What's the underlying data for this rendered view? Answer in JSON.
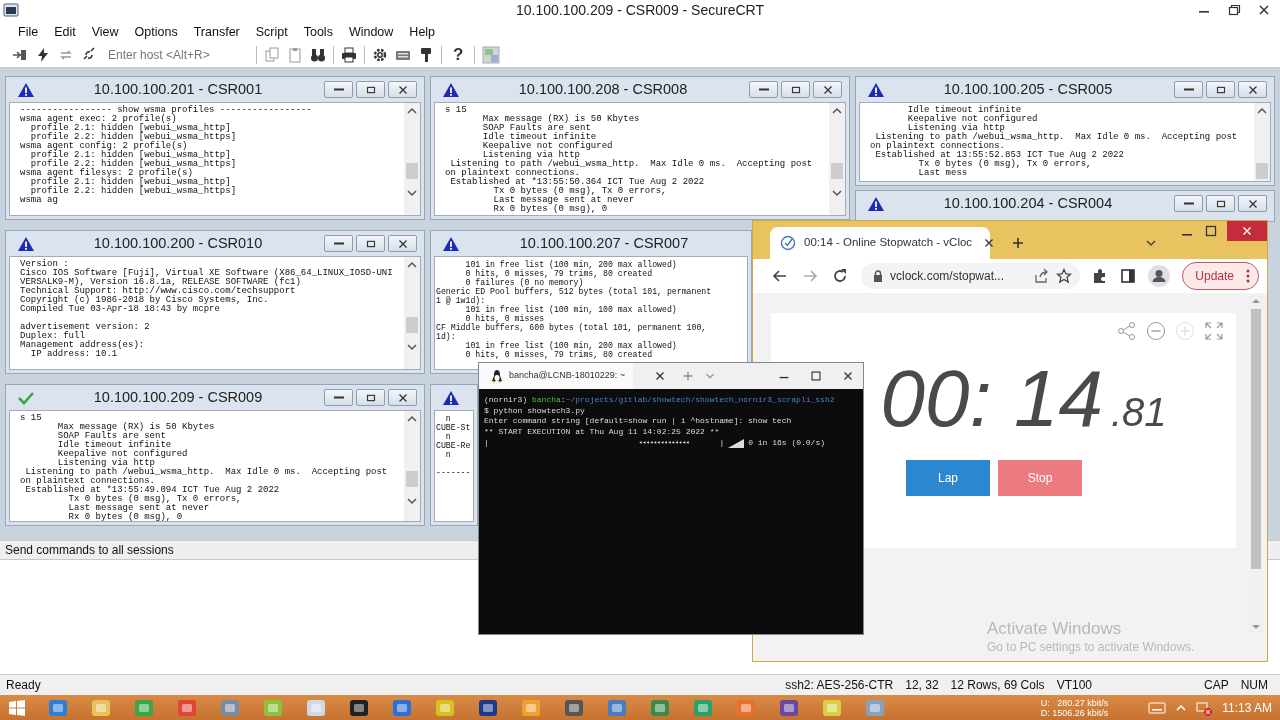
{
  "window": {
    "title": "10.100.100.209 - CSR009 - SecureCRT"
  },
  "menu": [
    "File",
    "Edit",
    "View",
    "Options",
    "Transfer",
    "Script",
    "Tools",
    "Window",
    "Help"
  ],
  "toolbar": {
    "host_placeholder": "Enter host <Alt+R>",
    "help_glyph": "?"
  },
  "sessions": [
    {
      "title": "10.100.100.201 - CSR001",
      "connected": false,
      "blocks": [
        [
          "----------------- show wsma profiles -----------------",
          "wsma agent exec: 2 profile(s)",
          "  profile 2.1: hidden [webui_wsma_http]",
          "  profile 2.2: hidden [webui_wsma_https]",
          "wsma agent config: 2 profile(s)",
          "  profile 2.1: hidden [webui_wsma_http]",
          "  profile 2.2: hidden [webui_wsma_https]",
          "wsma agent filesys: 2 profile(s)",
          "  profile 2.1: hidden [webui_wsma_http]",
          "  profile 2.2: hidden [webui_wsma_https]",
          "wsma ag"
        ]
      ]
    },
    {
      "title": "10.100.100.208 - CSR008",
      "connected": false,
      "blocks": [
        [
          "s 15",
          "       Max message (RX) is 50 Kbytes",
          "       SOAP Faults are sent",
          "       Idle timeout infinite",
          "       Keepalive not configured",
          "       Listening via http",
          " Listening to path /webui_wsma_http.  Max Idle 0 ms.  Accepting post",
          "on plaintext connections.",
          " Established at *13:55:50.364 ICT Tue Aug 2 2022",
          "         Tx 0 bytes (0 msg), Tx 0 errors,",
          "         Last message sent at never",
          "         Rx 0 bytes (0 msg), 0"
        ]
      ]
    },
    {
      "title": "10.100.100.205 - CSR005",
      "connected": false,
      "blocks": [
        [
          "       Idle timeout infinite",
          "       Keepalive not configured",
          "       Listening via http",
          " Listening to path /webui_wsma_http.  Max Idle 0 ms.  Accepting post",
          "on plaintext connections.",
          " Established at 13:55:52.853 ICT Tue Aug 2 2022",
          "         Tx 0 bytes (0 msg), Tx 0 errors,",
          "         Last mess"
        ]
      ]
    },
    {
      "title": "10.100.100.200 - CSR010",
      "connected": false,
      "blocks": [
        [
          "Version :",
          "Cisco IOS Software [Fuji], Virtual XE Software (X86_64_LINUX_IOSD-UNI",
          "VERSALK9-M), Version 16.8.1a, RELEASE SOFTWARE (fc1)",
          "Technical Support: http://www.cisco.com/techsupport",
          "Copyright (c) 1986-2018 by Cisco Systems, Inc.",
          "Compiled Tue 03-Apr-18 18:43 by mcpre"
        ],
        [
          "advertisement version: 2",
          "Duplex: full",
          "Management address(es):",
          "  IP address: 10.1"
        ]
      ]
    },
    {
      "title": "10.100.100.207 - CSR007",
      "connected": false,
      "blocks": [
        [
          "      101 in free list (100 min, 200 max allowed)",
          "      0 hits, 0 misses, 79 trims, 80 created",
          "      0 failures (0 no memory)",
          "Generic ED Pool buffers, 512 bytes (total 101, permanent",
          "1 @ 1w1d):",
          "      101 in free list (100 min, 100 max allowed)",
          "      0 hits, 0 misses",
          "CF Middle buffers, 600 bytes (total 101, permanent 100,",
          "1d):",
          "      101 in free list (100 min, 200 max allowed)",
          "      0 hits, 0 misses, 79 trims, 80 created"
        ]
      ]
    },
    {
      "title": "10.100.100.204 - CSR004",
      "connected": false
    },
    {
      "title": "10.100.100.209 - CSR009",
      "connected": true,
      "blocks": [
        [
          "s 15",
          "       Max message (RX) is 50 Kbytes",
          "       SOAP Faults are sent",
          "       Idle timeout infinite",
          "       Keepalive not configured",
          "       Listening via http",
          " Listening to path /webui_wsma_http.  Max Idle 0 ms.  Accepting post",
          "on plaintext connections.",
          " Established at *13:55:49.094 ICT Tue Aug 2 2022",
          "         Tx 0 bytes (0 msg), Tx 0 errors,",
          "         Last message sent at never",
          "         Rx 0 bytes (0 msg), 0"
        ]
      ]
    },
    {
      "connected": false,
      "blocks": [
        [
          "  n",
          "CUBE-St",
          "  n",
          "CUBE-Re",
          "  n"
        ],
        [
          "-------"
        ]
      ]
    }
  ],
  "command_bar": "Send commands to all sessions",
  "terminal": {
    "tab": "bancha@LCNB-18010229: ~",
    "lines": [
      [
        {
          "text": "(nornir3) ",
          "kind": "plain"
        },
        {
          "text": "bancha",
          "kind": "user"
        },
        {
          "text": ":",
          "kind": "plain"
        },
        {
          "text": "~/projects/gitlab/showtech/showtech_nornir3_scrapli_ssh2",
          "kind": "path"
        }
      ],
      [
        {
          "text": "$ python showtech3.py",
          "kind": "plain"
        }
      ],
      [
        {
          "text": "Enter command string [default=show run | i ^hostname]: show tech",
          "kind": "plain"
        }
      ],
      [
        {
          "text": "** START EXECUTION at Thu Aug 11 14:02:25 2022 **",
          "kind": "plain"
        }
      ]
    ],
    "progress": {
      "start_mark": "|",
      "spinner": "◂◂◂◂◂◂◂◂◂◂◂◂◂◂",
      "divider": "|",
      "reading": "0 in 16s (0.0/s)"
    }
  },
  "browser": {
    "tab_title": "00:14 - Online Stopwatch - vCloc",
    "url": "vclock.com/stopwat...",
    "update_label": "Update",
    "back": {
      "disabled": false
    },
    "forward": {
      "disabled": true
    },
    "zoom_controls": [
      {
        "kind": "out",
        "disabled": false
      },
      {
        "kind": "in",
        "disabled": true
      }
    ],
    "stopwatch": {
      "main": "00: 14",
      "fraction": ".81",
      "buttons": [
        {
          "label": "Lap",
          "kind": "lap"
        },
        {
          "label": "Stop",
          "kind": "stop"
        }
      ]
    }
  },
  "activation": {
    "title": "Activate Windows",
    "hint": "Go to PC settings to activate Windows."
  },
  "status_bar": {
    "message": "Ready",
    "fields": [
      "ssh2: AES-256-CTR",
      "12, 32",
      "12 Rows, 69 Cols",
      "VT100",
      "CAP",
      "NUM"
    ]
  },
  "taskbar": {
    "upload": "U:   280.27 kbit/s",
    "download": "D: 1506.26 kbit/s",
    "clock": "11:13 AM"
  }
}
